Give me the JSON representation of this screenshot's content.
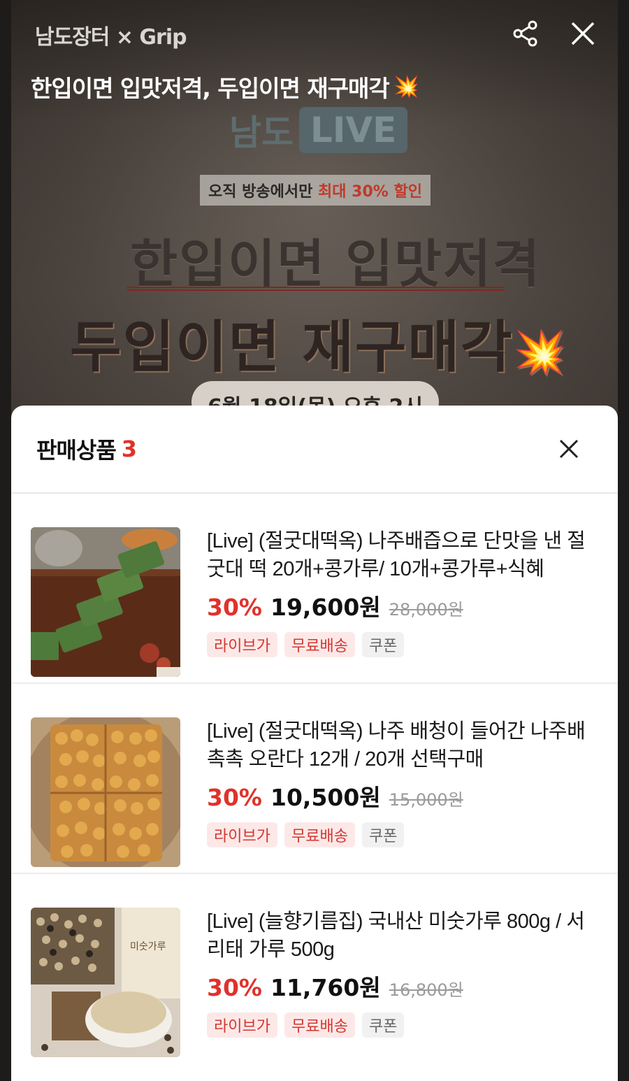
{
  "top_bar": {
    "brand": "남도장터 × Grip",
    "share_icon": "share-icon",
    "close_icon": "close-icon"
  },
  "live": {
    "title": "한입이면 입맛저격, 두입이면 재구매각",
    "title_emoji": "💥"
  },
  "poster": {
    "namdo": "남도",
    "live": "LIVE",
    "discount_prefix": "오직 방송에서만 ",
    "discount_highlight": "최대 30% 할인",
    "line1": "한입이면 입맛저격",
    "line2": "두입이면 재구매각",
    "line2_emoji": "💥",
    "date": "6월 18일(목) 오후 2시"
  },
  "sheet": {
    "title": "판매상품",
    "count": "3",
    "close_icon": "close-icon"
  },
  "products": [
    {
      "name": "[Live] (절굿대떡옥) 나주배즙으로 단맛을 낸 절굿대 떡 20개+콩가루/ 10개+콩가루+식혜",
      "rate": "30%",
      "price": "19,600원",
      "original": "28,000원",
      "tags": [
        "라이브가",
        "무료배송",
        "쿠폰"
      ]
    },
    {
      "name": "[Live] (절굿대떡옥) 나주 배청이 들어간 나주배 촉촉 오란다 12개 / 20개 선택구매",
      "rate": "30%",
      "price": "10,500원",
      "original": "15,000원",
      "tags": [
        "라이브가",
        "무료배송",
        "쿠폰"
      ]
    },
    {
      "name": "[Live] (늘향기름집) 국내산 미숫가루 800g / 서리태 가루 500g",
      "rate": "30%",
      "price": "11,760원",
      "original": "16,800원",
      "tags": [
        "라이브가",
        "무료배송",
        "쿠폰"
      ]
    }
  ],
  "colors": {
    "accent": "#e0322b",
    "tag_red_bg": "#fde8e8",
    "tag_gray_bg": "#f1f1f1"
  }
}
